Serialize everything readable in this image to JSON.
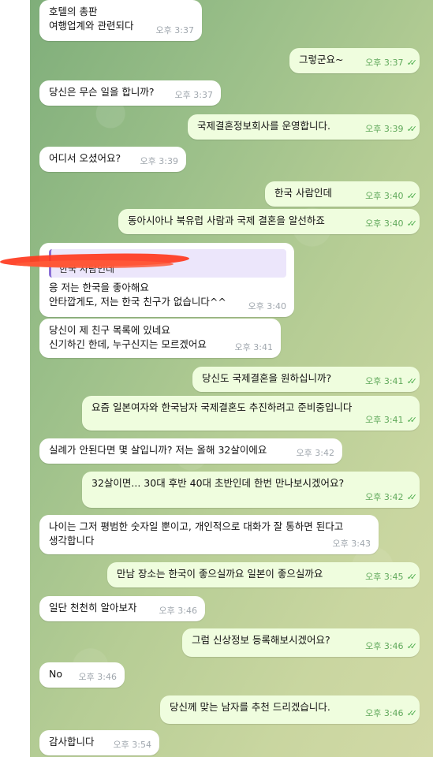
{
  "messages": [
    {
      "id": "m1",
      "dir": "in",
      "text": "호텔의 총판\n여행업계와 관련되다",
      "time": "오후 3:37"
    },
    {
      "id": "m2",
      "dir": "out",
      "text": "그렇군요~",
      "time": "오후 3:37"
    },
    {
      "id": "m3",
      "dir": "in",
      "text": "당신은 무슨 일을 합니까?",
      "time": "오후 3:37"
    },
    {
      "id": "m4",
      "dir": "out",
      "text": "국제결혼정보회사를 운영합니다.",
      "time": "오후 3:39"
    },
    {
      "id": "m5",
      "dir": "in",
      "text": "어디서 오셨어요?",
      "time": "오후 3:39"
    },
    {
      "id": "m6",
      "dir": "out",
      "text": "한국 사람인데",
      "time": "오후 3:40"
    },
    {
      "id": "m7",
      "dir": "out",
      "text": "동아시아나 북유럽 사람과 국제 결혼을 알선하죠",
      "time": "오후 3:40"
    },
    {
      "id": "m8",
      "dir": "in",
      "reply": "한국 사람인데",
      "text": "응 저는 한국을 좋아해요\n안타깝게도, 저는 한국 친구가 없습니다^^",
      "time": "오후 3:40"
    },
    {
      "id": "m9",
      "dir": "in",
      "text": "당신이 제 친구 목록에 있네요\n신기하긴 한데, 누구신지는 모르겠어요",
      "time": "오후 3:41"
    },
    {
      "id": "m10",
      "dir": "out",
      "text": "당신도 국제결혼을 원하십니까?",
      "time": "오후 3:41"
    },
    {
      "id": "m11",
      "dir": "out",
      "text": "요즘 일본여자와 한국남자 국제결혼도 추진하려고 준비중입니다",
      "time": "오후 3:41"
    },
    {
      "id": "m12",
      "dir": "in",
      "text": "실례가 안된다면 몇 살입니까? 저는 올해 32살이에요",
      "time": "오후 3:42"
    },
    {
      "id": "m13",
      "dir": "out",
      "text": "32살이면... 30대 후반 40대 초반인데 한번 만나보시겠어요?",
      "time": "오후 3:42"
    },
    {
      "id": "m14",
      "dir": "in",
      "text": "나이는 그저 평범한 숫자일 뿐이고, 개인적으로 대화가 잘 통하면 된다고\n생각합니다",
      "time": "오후 3:43"
    },
    {
      "id": "m15",
      "dir": "out",
      "text": "만남 장소는 한국이 좋으실까요 일본이 좋으실까요",
      "time": "오후 3:45"
    },
    {
      "id": "m16",
      "dir": "in",
      "text": "일단 천천히 알아보자",
      "time": "오후 3:46"
    },
    {
      "id": "m17",
      "dir": "out",
      "text": "그럼 신상정보 등록해보시겠어요?",
      "time": "오후 3:46"
    },
    {
      "id": "m18",
      "dir": "in",
      "text": "No",
      "time": "오후 3:46"
    },
    {
      "id": "m19",
      "dir": "out",
      "text": "당신께 맞는 남자를 추천 드리겠습니다.",
      "time": "오후 3:46"
    },
    {
      "id": "m20",
      "dir": "in",
      "text": "감사합니다",
      "time": "오후 3:54"
    }
  ]
}
